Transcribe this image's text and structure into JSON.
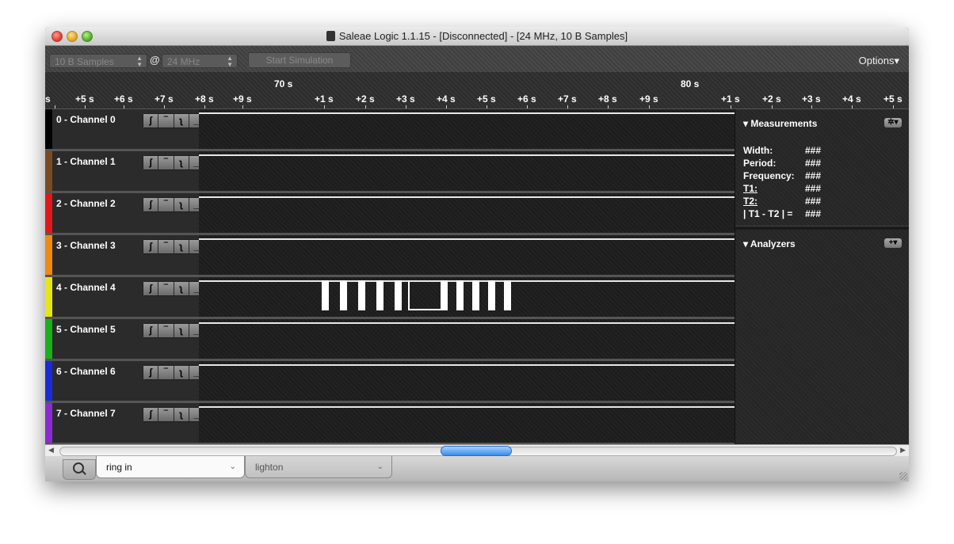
{
  "window": {
    "title": "Saleae Logic 1.1.15 - [Disconnected] - [24 MHz, 10 B Samples]"
  },
  "toolbar": {
    "samples": "10 B Samples",
    "at": "@",
    "rate": "24 MHz",
    "start_button": "Start Simulation",
    "options": "Options▾"
  },
  "ruler": {
    "major": [
      "70 s",
      "80 s"
    ],
    "ticks": [
      "s",
      "+5 s",
      "+6 s",
      "+7 s",
      "+8 s",
      "+9 s",
      "+1 s",
      "+2 s",
      "+3 s",
      "+4 s",
      "+5 s",
      "+6 s",
      "+7 s",
      "+8 s",
      "+9 s",
      "+1 s",
      "+2 s",
      "+3 s",
      "+4 s",
      "+5 s"
    ]
  },
  "channels": [
    {
      "name": "0 - Channel 0",
      "color": "#000000"
    },
    {
      "name": "1 - Channel 1",
      "color": "#7a4a22"
    },
    {
      "name": "2 - Channel 2",
      "color": "#e01818"
    },
    {
      "name": "3 - Channel 3",
      "color": "#ee8a10"
    },
    {
      "name": "4 - Channel 4",
      "color": "#e6e614"
    },
    {
      "name": "5 - Channel 5",
      "color": "#19b019"
    },
    {
      "name": "6 - Channel 6",
      "color": "#1a2ad8"
    },
    {
      "name": "7 - Channel 7",
      "color": "#8a2ad0"
    }
  ],
  "trigger": {
    "rising": "ʃ",
    "high": "‾",
    "falling": "ʅ",
    "low": "_"
  },
  "measurements": {
    "header": "Measurements",
    "rows": [
      {
        "label": "Width:",
        "value": "###"
      },
      {
        "label": "Period:",
        "value": "###"
      },
      {
        "label": "Frequency:",
        "value": "###"
      },
      {
        "label": "T1:",
        "value": "###"
      },
      {
        "label": "T2:",
        "value": "###"
      },
      {
        "label": "| T1 - T2 | =",
        "value": "###"
      }
    ]
  },
  "analyzers": {
    "header": "Analyzers"
  },
  "tabs": [
    {
      "label": "ring in",
      "active": true
    },
    {
      "label": "lighton",
      "active": false
    }
  ]
}
